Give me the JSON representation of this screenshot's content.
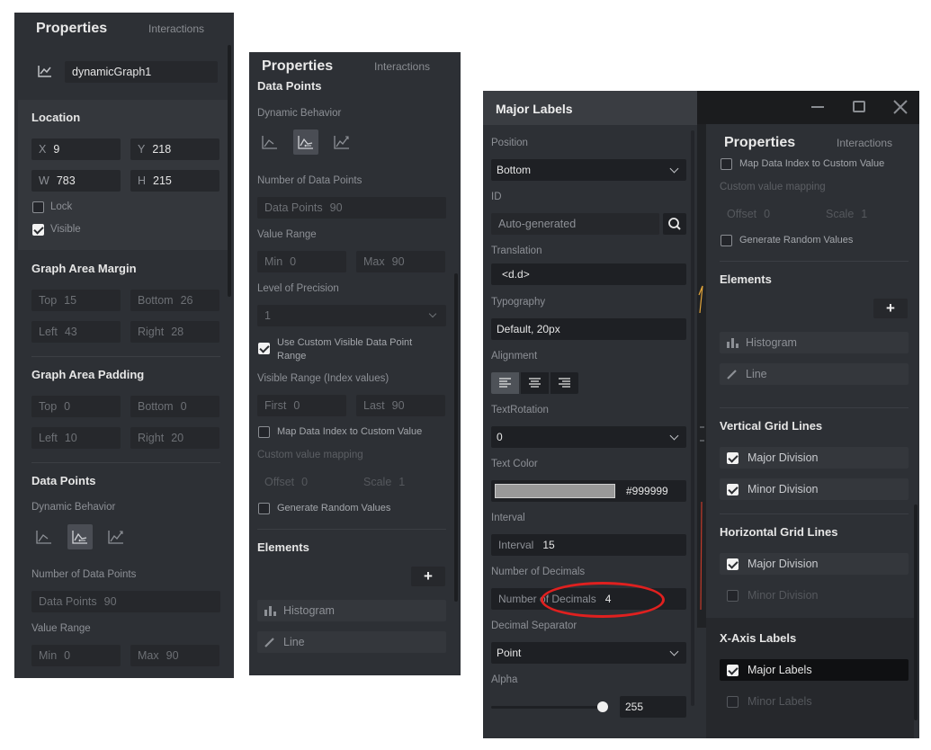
{
  "panel1": {
    "title": "Properties",
    "tab": "Interactions",
    "name": "dynamicGraph1",
    "location": {
      "heading": "Location",
      "x_key": "X",
      "x": "9",
      "y_key": "Y",
      "y": "218",
      "w_key": "W",
      "w": "783",
      "h_key": "H",
      "h": "215",
      "lock": "Lock",
      "visible": "Visible"
    },
    "margin": {
      "heading": "Graph Area Margin",
      "top_key": "Top",
      "top": "15",
      "bottom_key": "Bottom",
      "bottom": "26",
      "left_key": "Left",
      "left": "43",
      "right_key": "Right",
      "right": "28"
    },
    "padding": {
      "heading": "Graph Area Padding",
      "top_key": "Top",
      "top": "0",
      "bottom_key": "Bottom",
      "bottom": "0",
      "left_key": "Left",
      "left": "10",
      "right_key": "Right",
      "right": "20"
    },
    "datapoints": {
      "heading": "Data Points",
      "behavior": "Dynamic Behavior",
      "num_label": "Number of Data Points",
      "num_key": "Data Points",
      "num": "90",
      "range_label": "Value Range",
      "min_key": "Min",
      "min": "0",
      "max_key": "Max",
      "max": "90"
    }
  },
  "panel2": {
    "title": "Properties",
    "tab": "Interactions",
    "heading": "Data Points",
    "behavior": "Dynamic Behavior",
    "num_label": "Number of Data Points",
    "num_key": "Data Points",
    "num": "90",
    "range_label": "Value Range",
    "min_key": "Min",
    "min": "0",
    "max_key": "Max",
    "max": "90",
    "precision_label": "Level of Precision",
    "precision": "1",
    "custom_range_line1": "Use Custom Visible Data Point",
    "custom_range_line2": "Range",
    "visible_range_label": "Visible Range (Index values)",
    "first_key": "First",
    "first": "0",
    "last_key": "Last",
    "last": "90",
    "map_index": "Map Data Index to Custom Value",
    "custom_mapping": "Custom value mapping",
    "offset_key": "Offset",
    "offset": "0",
    "scale_key": "Scale",
    "scale": "1",
    "random": "Generate Random Values",
    "elements": "Elements",
    "add": "+",
    "histogram": "Histogram",
    "line": "Line"
  },
  "panel3": {
    "title": "Major Labels",
    "position_label": "Position",
    "position": "Bottom",
    "id_label": "ID",
    "id_placeholder": "Auto-generated",
    "translation_label": "Translation",
    "translation": "<d.d>",
    "typography_label": "Typography",
    "typography": "Default, 20px",
    "alignment_label": "Alignment",
    "rotation_label": "TextRotation",
    "rotation": "0",
    "color_label": "Text Color",
    "color_hex": "#999999",
    "interval_label": "Interval",
    "interval_key": "Interval",
    "interval": "15",
    "decimals_label": "Number of Decimals",
    "decimals_key": "Number of Decimals",
    "decimals": "4",
    "separator_label": "Decimal Separator",
    "separator": "Point",
    "alpha_label": "Alpha",
    "alpha": "255",
    "alpha_fraction": 0.95
  },
  "panel4": {
    "title": "Properties",
    "tab": "Interactions",
    "map_index": "Map Data Index to Custom Value",
    "custom_mapping": "Custom value mapping",
    "offset_key": "Offset",
    "offset": "0",
    "scale_key": "Scale",
    "scale": "1",
    "random": "Generate Random Values",
    "elements": "Elements",
    "add": "+",
    "histogram": "Histogram",
    "line": "Line",
    "vgrid": "Vertical Grid Lines",
    "vmajor": "Major Division",
    "vminor": "Minor Division",
    "hgrid": "Horizontal Grid Lines",
    "hmajor": "Major Division",
    "hminor": "Minor Division",
    "xaxis": "X-Axis Labels",
    "major_labels": "Major Labels",
    "minor_labels": "Minor Labels"
  },
  "colors": {
    "panel_bg": "#2d3035",
    "field_bg": "#26282c",
    "highlight_circle": "#e0201f",
    "swatch": "#999999"
  }
}
